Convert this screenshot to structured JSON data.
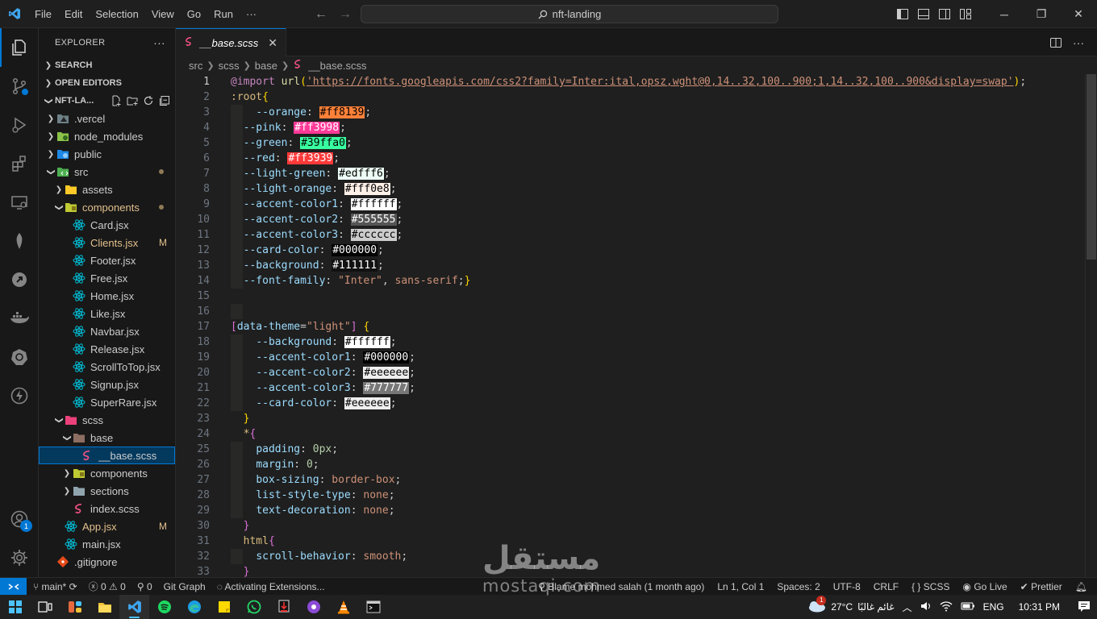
{
  "titlebar": {
    "menu": [
      "File",
      "Edit",
      "Selection",
      "View",
      "Go",
      "Run",
      "···"
    ],
    "search": "nft-landing"
  },
  "activity": {
    "items": [
      "explorer-icon",
      "source-control-icon",
      "run-debug-icon",
      "extensions-icon",
      "remote-explorer-icon",
      "mongodb-icon",
      "git-graph-icon",
      "docker-icon",
      "kubernetes-icon",
      "thunder-client-icon"
    ],
    "accounts_badge": "1"
  },
  "sidebar": {
    "title": "EXPLORER",
    "more": "···",
    "sections": {
      "search": "SEARCH",
      "open_editors": "OPEN EDITORS",
      "project": "NFT-LA..."
    },
    "tree": [
      {
        "label": ".vercel",
        "depth": 1,
        "type": "folder-vercel",
        "open": false,
        "deco": ""
      },
      {
        "label": "node_modules",
        "depth": 1,
        "type": "folder-node",
        "open": false,
        "deco": ""
      },
      {
        "label": "public",
        "depth": 1,
        "type": "folder-public",
        "open": false,
        "deco": ""
      },
      {
        "label": "src",
        "depth": 1,
        "type": "folder-src",
        "open": true,
        "deco": "dot"
      },
      {
        "label": "assets",
        "depth": 2,
        "type": "folder-assets",
        "open": false,
        "deco": ""
      },
      {
        "label": "components",
        "depth": 2,
        "type": "folder-components",
        "open": true,
        "deco": "dot",
        "modified": true
      },
      {
        "label": "Card.jsx",
        "depth": 3,
        "type": "react",
        "deco": ""
      },
      {
        "label": "Clients.jsx",
        "depth": 3,
        "type": "react",
        "deco": "M",
        "modified": true
      },
      {
        "label": "Footer.jsx",
        "depth": 3,
        "type": "react",
        "deco": ""
      },
      {
        "label": "Free.jsx",
        "depth": 3,
        "type": "react",
        "deco": ""
      },
      {
        "label": "Home.jsx",
        "depth": 3,
        "type": "react",
        "deco": ""
      },
      {
        "label": "Like.jsx",
        "depth": 3,
        "type": "react",
        "deco": ""
      },
      {
        "label": "Navbar.jsx",
        "depth": 3,
        "type": "react",
        "deco": ""
      },
      {
        "label": "Release.jsx",
        "depth": 3,
        "type": "react",
        "deco": ""
      },
      {
        "label": "ScrollToTop.jsx",
        "depth": 3,
        "type": "react",
        "deco": ""
      },
      {
        "label": "Signup.jsx",
        "depth": 3,
        "type": "react",
        "deco": ""
      },
      {
        "label": "SuperRare.jsx",
        "depth": 3,
        "type": "react",
        "deco": ""
      },
      {
        "label": "scss",
        "depth": 2,
        "type": "folder-sass",
        "open": true,
        "deco": ""
      },
      {
        "label": "base",
        "depth": 3,
        "type": "folder-base",
        "open": true,
        "deco": ""
      },
      {
        "label": "__base.scss",
        "depth": 4,
        "type": "sass",
        "deco": "",
        "selected": true
      },
      {
        "label": "components",
        "depth": 3,
        "type": "folder-components",
        "open": false,
        "deco": ""
      },
      {
        "label": "sections",
        "depth": 3,
        "type": "folder-plain",
        "open": false,
        "deco": ""
      },
      {
        "label": "index.scss",
        "depth": 3,
        "type": "sass",
        "deco": ""
      },
      {
        "label": "App.jsx",
        "depth": 2,
        "type": "react",
        "deco": "M",
        "modified": true
      },
      {
        "label": "main.jsx",
        "depth": 2,
        "type": "react",
        "deco": ""
      },
      {
        "label": ".gitignore",
        "depth": 1,
        "type": "git",
        "deco": ""
      }
    ]
  },
  "editor": {
    "tab": "__base.scss",
    "breadcrumbs": [
      "src",
      "scss",
      "base",
      "__base.scss"
    ],
    "cursor_line": 1,
    "lines": [
      [
        [
          "at",
          "@import"
        ],
        [
          "t",
          " "
        ],
        [
          "fn",
          "url"
        ],
        [
          "br1",
          "("
        ],
        [
          "url",
          "'https://fonts.googleapis.com/css2?family=Inter:ital,opsz,wght@0,14..32,100..900;1,14..32,100..900&display=swap'"
        ],
        [
          "br1",
          ")"
        ],
        [
          "punc",
          ";"
        ]
      ],
      [
        [
          "sel",
          ":root"
        ],
        [
          "br1",
          "{"
        ]
      ],
      [
        [
          "t",
          "    "
        ],
        [
          "var",
          "--orange"
        ],
        [
          "punc",
          ": "
        ],
        [
          "sw",
          "#ff8139",
          "#ff8139"
        ],
        [
          "punc",
          ";"
        ]
      ],
      [
        [
          "t",
          "  "
        ],
        [
          "var",
          "--pink"
        ],
        [
          "punc",
          ": "
        ],
        [
          "sw",
          "#ff3998",
          "#ff3998"
        ],
        [
          "punc",
          ";"
        ]
      ],
      [
        [
          "t",
          "  "
        ],
        [
          "var",
          "--green"
        ],
        [
          "punc",
          ": "
        ],
        [
          "sw",
          "#39ffa0",
          "#39ffa0"
        ],
        [
          "punc",
          ";"
        ]
      ],
      [
        [
          "t",
          "  "
        ],
        [
          "var",
          "--red"
        ],
        [
          "punc",
          ": "
        ],
        [
          "sw",
          "#ff3939",
          "#ff3939"
        ],
        [
          "punc",
          ";"
        ]
      ],
      [
        [
          "t",
          "  "
        ],
        [
          "var",
          "--light-green"
        ],
        [
          "punc",
          ": "
        ],
        [
          "sw",
          "#edfff6",
          "#edfff6"
        ],
        [
          "punc",
          ";"
        ]
      ],
      [
        [
          "t",
          "  "
        ],
        [
          "var",
          "--light-orange"
        ],
        [
          "punc",
          ": "
        ],
        [
          "sw",
          "#fff0e8",
          "#fff0e8"
        ],
        [
          "punc",
          ";"
        ]
      ],
      [
        [
          "t",
          "  "
        ],
        [
          "var",
          "--accent-color1"
        ],
        [
          "punc",
          ": "
        ],
        [
          "sw",
          "#ffffff",
          "#ffffff"
        ],
        [
          "punc",
          ";"
        ]
      ],
      [
        [
          "t",
          "  "
        ],
        [
          "var",
          "--accent-color2"
        ],
        [
          "punc",
          ": "
        ],
        [
          "sw",
          "#555555",
          "#555555"
        ],
        [
          "punc",
          ";"
        ]
      ],
      [
        [
          "t",
          "  "
        ],
        [
          "var",
          "--accent-color3"
        ],
        [
          "punc",
          ": "
        ],
        [
          "sw",
          "#cccccc",
          "#cccccc"
        ],
        [
          "punc",
          ";"
        ]
      ],
      [
        [
          "t",
          "  "
        ],
        [
          "var",
          "--card-color"
        ],
        [
          "punc",
          ": "
        ],
        [
          "sw",
          "#000000",
          "#000000"
        ],
        [
          "punc",
          ";"
        ]
      ],
      [
        [
          "t",
          "  "
        ],
        [
          "var",
          "--background"
        ],
        [
          "punc",
          ": "
        ],
        [
          "sw",
          "#111111",
          "#111111"
        ],
        [
          "punc",
          ";"
        ]
      ],
      [
        [
          "t",
          "  "
        ],
        [
          "var",
          "--font-family"
        ],
        [
          "punc",
          ": "
        ],
        [
          "str",
          "\"Inter\""
        ],
        [
          "punc",
          ", "
        ],
        [
          "kw",
          "sans-serif"
        ],
        [
          "punc",
          ";"
        ],
        [
          "br1",
          "}"
        ]
      ],
      [],
      [
        [
          "t",
          "  "
        ]
      ],
      [
        [
          "br2",
          "["
        ],
        [
          "attr",
          "data-theme"
        ],
        [
          "punc",
          "="
        ],
        [
          "str",
          "\"light\""
        ],
        [
          "br2",
          "]"
        ],
        [
          "t",
          " "
        ],
        [
          "br1",
          "{"
        ]
      ],
      [
        [
          "t",
          "    "
        ],
        [
          "var",
          "--background"
        ],
        [
          "punc",
          ": "
        ],
        [
          "sw",
          "#ffffff",
          "#ffffff"
        ],
        [
          "punc",
          ";"
        ]
      ],
      [
        [
          "t",
          "    "
        ],
        [
          "var",
          "--accent-color1"
        ],
        [
          "punc",
          ": "
        ],
        [
          "sw",
          "#000000",
          "#000000"
        ],
        [
          "punc",
          ";"
        ]
      ],
      [
        [
          "t",
          "    "
        ],
        [
          "var",
          "--accent-color2"
        ],
        [
          "punc",
          ": "
        ],
        [
          "sw",
          "#eeeeee",
          "#eeeeee"
        ],
        [
          "punc",
          ";"
        ]
      ],
      [
        [
          "t",
          "    "
        ],
        [
          "var",
          "--accent-color3"
        ],
        [
          "punc",
          ": "
        ],
        [
          "sw",
          "#777777",
          "#777777"
        ],
        [
          "punc",
          ";"
        ]
      ],
      [
        [
          "t",
          "    "
        ],
        [
          "var",
          "--card-color"
        ],
        [
          "punc",
          ": "
        ],
        [
          "sw",
          "#eeeeee",
          "#eeeeee"
        ],
        [
          "punc",
          ";"
        ]
      ],
      [
        [
          "t",
          "  "
        ],
        [
          "br1",
          "}"
        ]
      ],
      [
        [
          "t",
          "  "
        ],
        [
          "sel",
          "*"
        ],
        [
          "br2",
          "{"
        ]
      ],
      [
        [
          "t",
          "    "
        ],
        [
          "prop",
          "padding"
        ],
        [
          "punc",
          ": "
        ],
        [
          "num",
          "0px"
        ],
        [
          "punc",
          ";"
        ]
      ],
      [
        [
          "t",
          "    "
        ],
        [
          "prop",
          "margin"
        ],
        [
          "punc",
          ": "
        ],
        [
          "num",
          "0"
        ],
        [
          "punc",
          ";"
        ]
      ],
      [
        [
          "t",
          "    "
        ],
        [
          "prop",
          "box-sizing"
        ],
        [
          "punc",
          ": "
        ],
        [
          "kw",
          "border-box"
        ],
        [
          "punc",
          ";"
        ]
      ],
      [
        [
          "t",
          "    "
        ],
        [
          "prop",
          "list-style-type"
        ],
        [
          "punc",
          ": "
        ],
        [
          "kw",
          "none"
        ],
        [
          "punc",
          ";"
        ]
      ],
      [
        [
          "t",
          "    "
        ],
        [
          "prop",
          "text-decoration"
        ],
        [
          "punc",
          ": "
        ],
        [
          "kw",
          "none"
        ],
        [
          "punc",
          ";"
        ]
      ],
      [
        [
          "t",
          "  "
        ],
        [
          "br2",
          "}"
        ]
      ],
      [
        [
          "t",
          "  "
        ],
        [
          "sel",
          "html"
        ],
        [
          "br2",
          "{"
        ]
      ],
      [
        [
          "t",
          "    "
        ],
        [
          "prop",
          "scroll-behavior"
        ],
        [
          "punc",
          ": "
        ],
        [
          "kw",
          "smooth"
        ],
        [
          "punc",
          ";"
        ]
      ],
      [
        [
          "t",
          "  "
        ],
        [
          "br2",
          "}"
        ]
      ]
    ]
  },
  "statusbar": {
    "branch": "main*",
    "errors": "0",
    "warnings": "0",
    "ports": "0",
    "git_graph": "Git Graph",
    "activity": "Activating Extensions...",
    "blame": "Blame mohmed salah (1 month ago)",
    "position": "Ln 1, Col 1",
    "spaces": "Spaces: 2",
    "encoding": "UTF-8",
    "eol": "CRLF",
    "language": "SCSS",
    "golive": "Go Live",
    "prettier": "Prettier"
  },
  "taskbar": {
    "apps": [
      "windows-start-icon",
      "task-view-icon",
      "widgets-icon",
      "file-explorer-icon",
      "vscode-icon",
      "spotify-icon",
      "edge-icon",
      "sticky-notes-icon",
      "whatsapp-icon",
      "downloader-icon",
      "podcast-icon",
      "vlc-icon",
      "terminal-icon"
    ],
    "weather_temp": "27°C",
    "weather_text": "غائم غالبًا",
    "weather_badge": "1",
    "lang": "ENG",
    "time": "10:31 PM"
  },
  "watermark": {
    "arabic": "مستقل",
    "latin": "mostaqi.com"
  }
}
